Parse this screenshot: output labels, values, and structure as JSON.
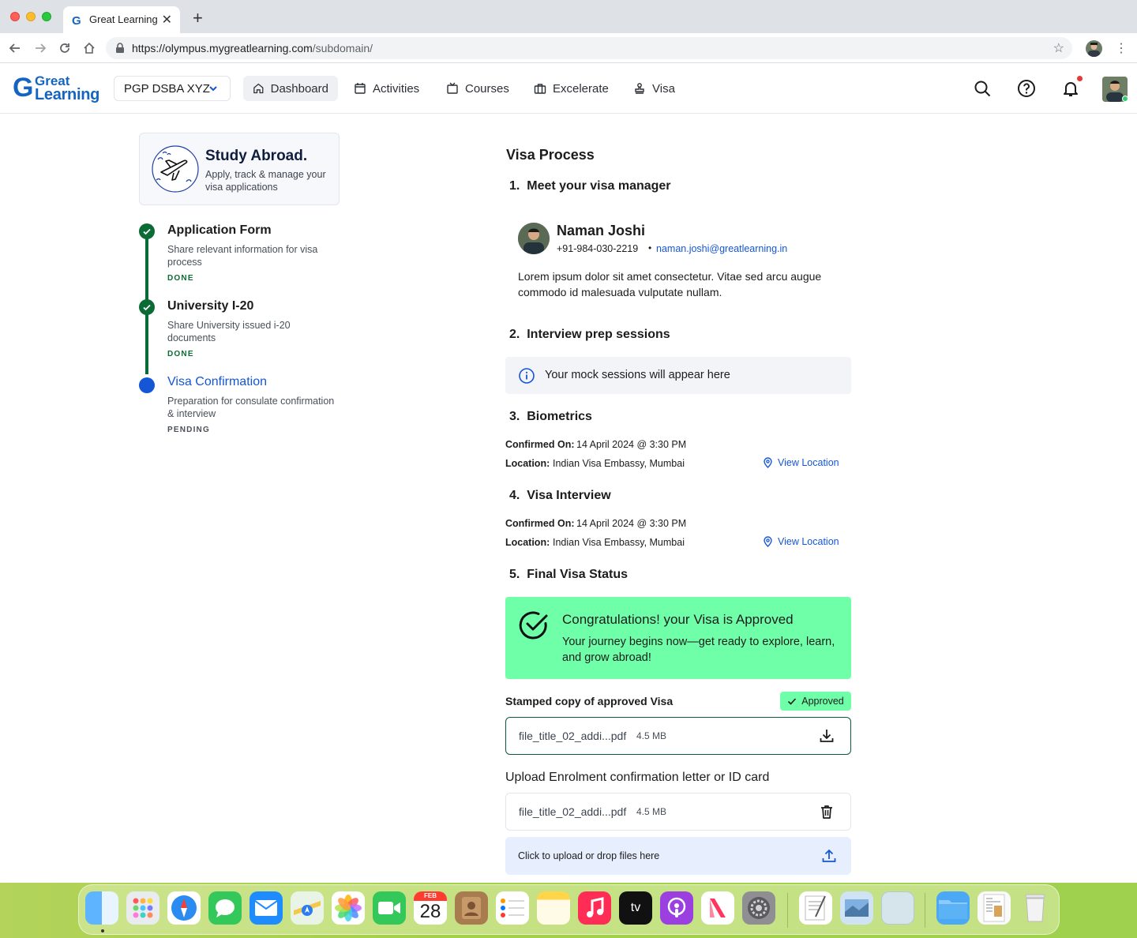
{
  "browser": {
    "tab_title": "Great Learning",
    "url_host": "https://olympus.mygreatlearning.com",
    "url_path": "/subdomain/"
  },
  "header": {
    "logo_letter": "G",
    "logo_line1": "Great",
    "logo_line2": "Learning",
    "program": "PGP DSBA XYZ",
    "nav": [
      {
        "label": "Dashboard",
        "icon": "home-icon",
        "active": true
      },
      {
        "label": "Activities",
        "icon": "calendar-icon",
        "active": false
      },
      {
        "label": "Courses",
        "icon": "tv-icon",
        "active": false
      },
      {
        "label": "Excelerate",
        "icon": "briefcase-icon",
        "active": false
      },
      {
        "label": "Visa",
        "icon": "stamp-icon",
        "active": false
      }
    ],
    "notification_color": "#e53935"
  },
  "sidebar": {
    "card_title": "Study Abroad.",
    "card_subtitle": "Apply, track & manage your visa applications",
    "steps": [
      {
        "title": "Application Form",
        "desc": "Share relevant information for visa process",
        "status": "DONE"
      },
      {
        "title": "University I-20",
        "desc": "Share University issued i-20 documents",
        "status": "DONE"
      },
      {
        "title": "Visa Confirmation",
        "desc": "Preparation for consulate confirmation & interview",
        "status": "PENDING"
      }
    ]
  },
  "main": {
    "title": "Visa Process",
    "s1": "1.  Meet your visa manager",
    "manager": {
      "name": "Naman Joshi",
      "phone": "+91-984-030-2219",
      "separator": "•",
      "email": "naman.joshi@greatlearning.in",
      "note": "Lorem ipsum dolor sit amet consectetur. Vitae sed arcu augue commodo id malesuada vulputate nullam."
    },
    "s2": "2.  Interview prep sessions",
    "mock_info": "Your mock sessions will appear here",
    "s3": "3.  Biometrics",
    "biometrics": {
      "confirmed_label": "Confirmed On:",
      "confirmed_value": "14 April 2024 @ 3:30 PM",
      "location_label": "Location:",
      "location_value": "Indian Visa Embassy, Mumbai",
      "link": "View Location"
    },
    "s4": "4.  Visa Interview",
    "interview": {
      "confirmed_label": "Confirmed On:",
      "confirmed_value": "14 April 2024 @ 3:30 PM",
      "location_label": "Location:",
      "location_value": "Indian Visa Embassy, Mumbai",
      "link": "View Location"
    },
    "s5": "5.  Final Visa Status",
    "approval": {
      "title": "Congratulations! your Visa is Approved",
      "subtitle": "Your journey begins now—get ready to explore, learn, and grow abroad!",
      "color": "#6effa8"
    },
    "stamped_label": "Stamped copy of approved Visa",
    "badge": "Approved",
    "stamped_file": {
      "name": "file_title_02_addi...pdf",
      "size": "4.5 MB"
    },
    "upload_title": "Upload Enrolment confirmation letter or ID card",
    "uploaded_file": {
      "name": "file_title_02_addi...pdf",
      "size": "4.5 MB"
    },
    "dropzone": "Click to upload or drop files here"
  },
  "dock": {
    "calendar_month": "FEB",
    "calendar_day": "28",
    "tv_label": "tv"
  }
}
